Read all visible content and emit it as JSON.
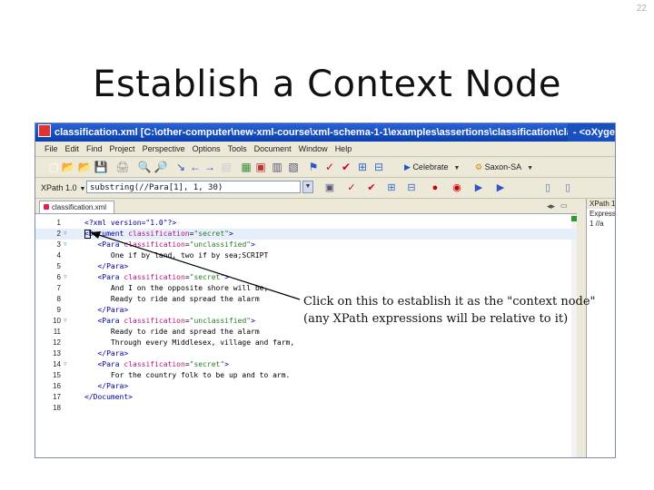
{
  "slide": {
    "number": "22",
    "title": "Establish a Context Node",
    "callout_line1": "Click on this to establish it as the \"context node\"",
    "callout_line2": "(any XPath expressions will be relative to it)"
  },
  "window": {
    "title": "classification.xml [C:\\other-computer\\new-xml-course\\xml-schema-1-1\\examples\\assertions\\classification\\classification.xml] - <oXyge",
    "title_visible": "classification.xml [C:\\other-computer\\new-xml-course\\xml-schema-1-1\\examples\\assertions\\classification\\classification.xml]",
    "title_right": "- <oXyge"
  },
  "menu": [
    "File",
    "Edit",
    "Find",
    "Project",
    "Perspective",
    "Options",
    "Tools",
    "Document",
    "Window",
    "Help"
  ],
  "toolbar": {
    "transform_combo": "Celebrate",
    "validation_combo": "Saxon-SA"
  },
  "xpath_bar": {
    "label": "XPath 1.0",
    "input_value": "substring(//Para[1], 1, 30)"
  },
  "editor": {
    "tab_label": "classification.xml",
    "tab_close": "✕",
    "lines": [
      {
        "n": "1",
        "fold": "",
        "html": "<span class=\"pi\">&lt;?xml version=\"1.0\"?&gt;</span>"
      },
      {
        "n": "2",
        "fold": "▿",
        "html": "<span class=\"tag\">&lt;Document</span> <span class=\"attr\">classification</span>=<span class=\"val\">\"secret\"</span><span class=\"tag\">&gt;</span>"
      },
      {
        "n": "3",
        "fold": "▿",
        "html": "   <span class=\"tag\">&lt;Para</span> <span class=\"attr\">classification</span>=<span class=\"val\">\"unclassified\"</span><span class=\"tag\">&gt;</span>"
      },
      {
        "n": "4",
        "fold": "",
        "html": "      One if by land, two if by sea;SCRIPT"
      },
      {
        "n": "5",
        "fold": "",
        "html": "   <span class=\"tag\">&lt;/Para&gt;</span>"
      },
      {
        "n": "6",
        "fold": "▿",
        "html": "   <span class=\"tag\">&lt;Para</span> <span class=\"attr\">classification</span>=<span class=\"val\">\"secret\"</span><span class=\"tag\">&gt;</span>"
      },
      {
        "n": "7",
        "fold": "",
        "html": "      And I on the opposite shore will be,"
      },
      {
        "n": "8",
        "fold": "",
        "html": "      Ready to ride and spread the alarm"
      },
      {
        "n": "9",
        "fold": "",
        "html": "   <span class=\"tag\">&lt;/Para&gt;</span>"
      },
      {
        "n": "10",
        "fold": "▿",
        "html": "   <span class=\"tag\">&lt;Para</span> <span class=\"attr\">classification</span>=<span class=\"val\">\"unclassified\"</span><span class=\"tag\">&gt;</span>"
      },
      {
        "n": "11",
        "fold": "",
        "html": "      Ready to ride and spread the alarm"
      },
      {
        "n": "12",
        "fold": "",
        "html": "      Through every Middlesex, village and farm,"
      },
      {
        "n": "13",
        "fold": "",
        "html": "   <span class=\"tag\">&lt;/Para&gt;</span>"
      },
      {
        "n": "14",
        "fold": "▿",
        "html": "   <span class=\"tag\">&lt;Para</span> <span class=\"attr\">classification</span>=<span class=\"val\">\"secret\"</span><span class=\"tag\">&gt;</span>"
      },
      {
        "n": "15",
        "fold": "",
        "html": "      For the country folk to be up and to arm."
      },
      {
        "n": "16",
        "fold": "",
        "html": "   <span class=\"tag\">&lt;/Para&gt;</span>"
      },
      {
        "n": "17",
        "fold": "",
        "html": "<span class=\"tag\">&lt;/Document&gt;</span>"
      },
      {
        "n": "18",
        "fold": "",
        "html": ""
      }
    ]
  },
  "right_panel": {
    "title": "XPath 1",
    "header": "Express",
    "row": "1 //a"
  },
  "icons": {
    "toolbar": [
      "new-icon",
      "open-icon",
      "open-folder-icon",
      "save-icon",
      "print-icon",
      "find-icon",
      "replace-icon",
      "back-icon",
      "forward-icon",
      "nav-left-icon",
      "nav-right-icon",
      "view-icon",
      "transform-icon",
      "debug-icon",
      "refresh-icon",
      "run-icon",
      "check-icon",
      "validate-icon",
      "tree-icon",
      "schema-icon",
      "stop-icon",
      "record-icon",
      "play-icon",
      "layout-icon",
      "layout2-icon",
      "layout3-icon"
    ]
  },
  "colors": {
    "titlebar": "#0b3fae",
    "tag": "#0000a0",
    "attribute": "#b0157d",
    "value": "#2a7a2a"
  }
}
